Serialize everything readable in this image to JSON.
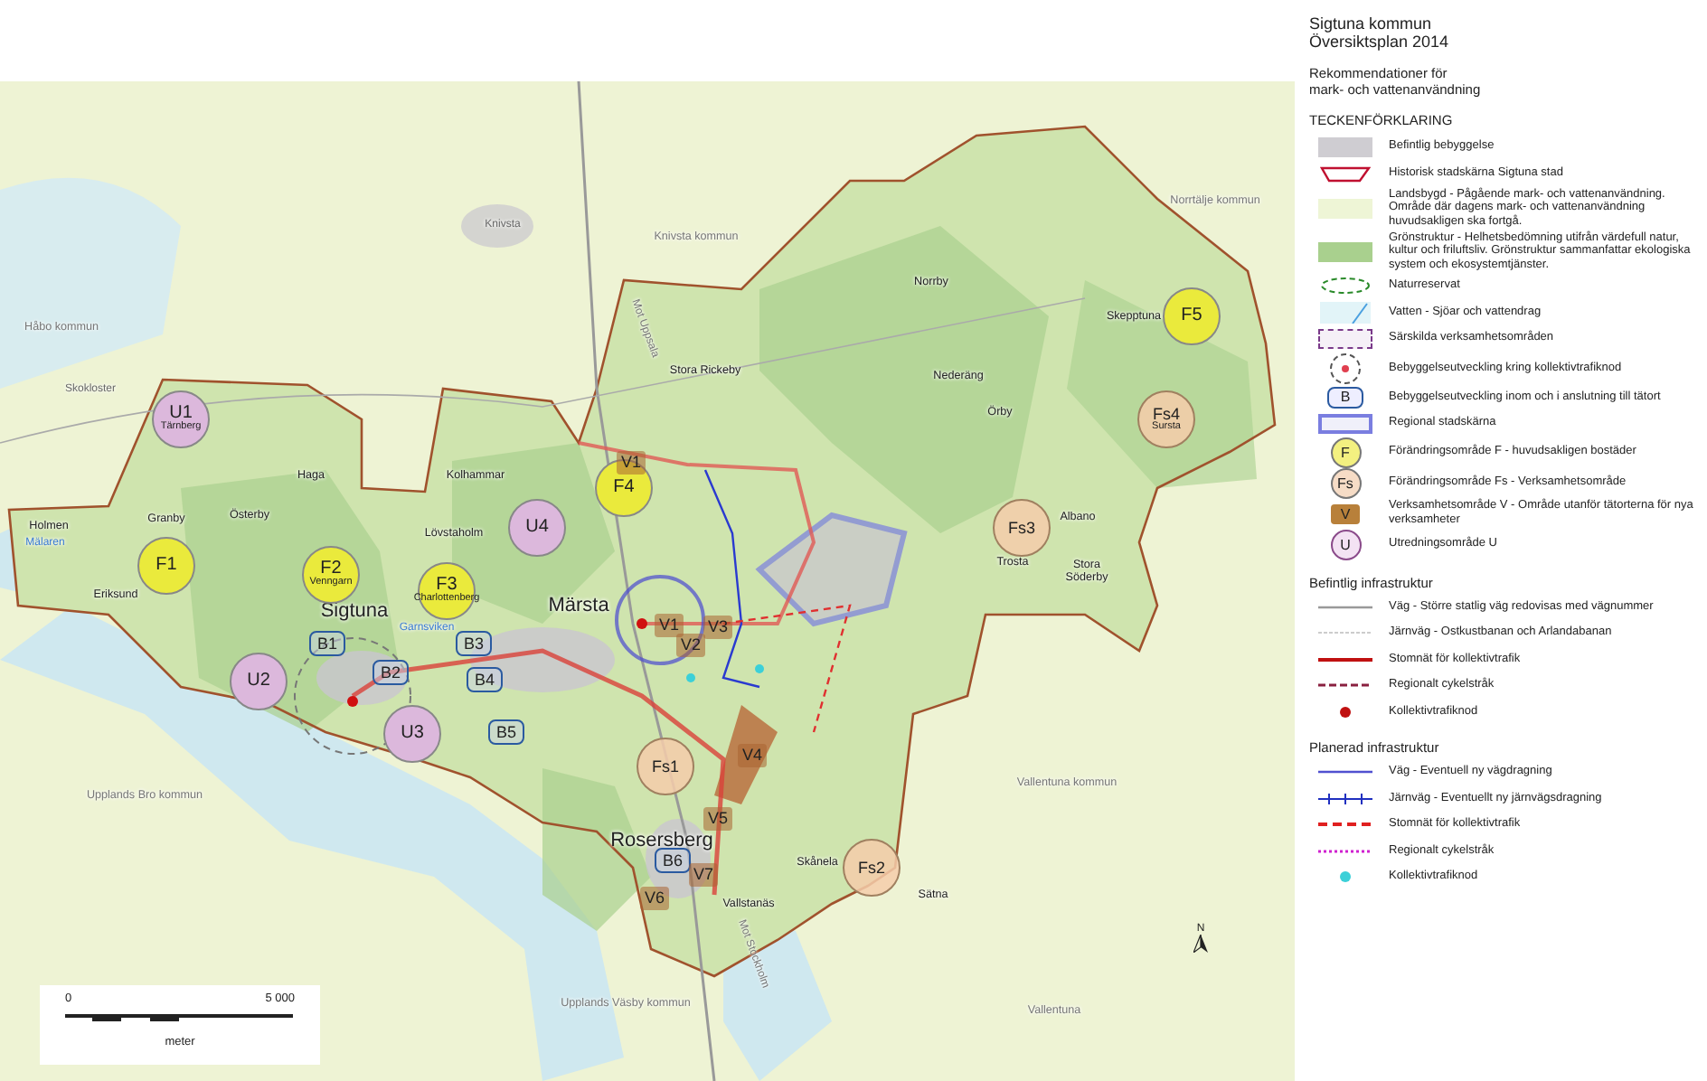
{
  "map": {
    "places": [
      {
        "text": "Knivsta",
        "kind": "village"
      },
      {
        "text": "Knivsta kommun",
        "kind": "municipality"
      },
      {
        "text": "Norrtälje kommun",
        "kind": "municipality"
      },
      {
        "text": "Håbo kommun",
        "kind": "municipality"
      },
      {
        "text": "Skokloster",
        "kind": "village"
      },
      {
        "text": "Mot Uppsala",
        "kind": "direction"
      },
      {
        "text": "Holmen",
        "kind": "place"
      },
      {
        "text": "Mälaren",
        "kind": "water"
      },
      {
        "text": "Granby",
        "kind": "place"
      },
      {
        "text": "Eriksund",
        "kind": "place"
      },
      {
        "text": "Haga",
        "kind": "place"
      },
      {
        "text": "Kolhammar",
        "kind": "place"
      },
      {
        "text": "Österby",
        "kind": "place"
      },
      {
        "text": "Lövstaholm",
        "kind": "place"
      },
      {
        "text": "Sigtuna",
        "kind": "town"
      },
      {
        "text": "Garnsviken",
        "kind": "water"
      },
      {
        "text": "Märsta",
        "kind": "town"
      },
      {
        "text": "Stora Rickeby",
        "kind": "place"
      },
      {
        "text": "Norrby",
        "kind": "place"
      },
      {
        "text": "Nederäng",
        "kind": "place"
      },
      {
        "text": "Örby",
        "kind": "place"
      },
      {
        "text": "Skepptuna",
        "kind": "place"
      },
      {
        "text": "Albano",
        "kind": "place"
      },
      {
        "text": "Trosta",
        "kind": "place"
      },
      {
        "text": "Stora Söderby",
        "kind": "place"
      },
      {
        "text": "Rosersberg",
        "kind": "town"
      },
      {
        "text": "Vallstanäs",
        "kind": "place"
      },
      {
        "text": "Skånela",
        "kind": "place"
      },
      {
        "text": "Sätna",
        "kind": "place"
      },
      {
        "text": "Vallentuna kommun",
        "kind": "municipality"
      },
      {
        "text": "Vallentuna",
        "kind": "municipality"
      },
      {
        "text": "Upplands Bro kommun",
        "kind": "municipality"
      },
      {
        "text": "Upplands Väsby kommun",
        "kind": "municipality"
      },
      {
        "text": "Mot Stockholm",
        "kind": "direction"
      }
    ],
    "zones": [
      {
        "label": "U1",
        "kind": "U",
        "sublabel": "Tärnberg"
      },
      {
        "label": "F1",
        "kind": "F"
      },
      {
        "label": "F2",
        "kind": "F",
        "sublabel": "Venngarn"
      },
      {
        "label": "F3",
        "kind": "F",
        "sublabel": "Charlottenberg"
      },
      {
        "label": "U4",
        "kind": "U"
      },
      {
        "label": "F4",
        "kind": "F"
      },
      {
        "label": "V1",
        "kind": "V"
      },
      {
        "label": "U2",
        "kind": "U"
      },
      {
        "label": "B1",
        "kind": "B"
      },
      {
        "label": "B2",
        "kind": "B"
      },
      {
        "label": "B3",
        "kind": "B"
      },
      {
        "label": "B4",
        "kind": "B"
      },
      {
        "label": "B5",
        "kind": "B"
      },
      {
        "label": "U3",
        "kind": "U"
      },
      {
        "label": "V1",
        "kind": "V"
      },
      {
        "label": "V2",
        "kind": "V"
      },
      {
        "label": "V3",
        "kind": "V"
      },
      {
        "label": "V4",
        "kind": "V"
      },
      {
        "label": "Fs1",
        "kind": "Fs"
      },
      {
        "label": "V5",
        "kind": "V"
      },
      {
        "label": "B6",
        "kind": "B"
      },
      {
        "label": "V6",
        "kind": "V"
      },
      {
        "label": "V7",
        "kind": "V"
      },
      {
        "label": "Fs2",
        "kind": "Fs"
      },
      {
        "label": "Fs3",
        "kind": "Fs"
      },
      {
        "label": "Fs4",
        "kind": "Fs",
        "sublabel": "Sursta"
      },
      {
        "label": "F5",
        "kind": "F"
      }
    ],
    "scale_bar": {
      "start": "0",
      "end": "5 000",
      "unit": "meter"
    },
    "north_arrow": "N"
  },
  "legend": {
    "title": "Sigtuna kommun\nÖversiktsplan 2014",
    "subtitle": "Rekommendationer för\nmark- och vattenanvändning",
    "heading": "TECKENFÖRKLARING",
    "items": [
      {
        "kind": "built",
        "text": "Befintlig bebyggelse"
      },
      {
        "kind": "historic",
        "text": "Historisk stadskärna Sigtuna stad"
      },
      {
        "kind": "rural",
        "text": "Landsbygd - Pågående mark- och vattenanvändning. Område där dagens mark- och vattenanvändning huvudsakligen ska fortgå."
      },
      {
        "kind": "green",
        "text": "Grönstruktur - Helhetsbedömning utifrån värdefull natur, kultur och friluftsliv. Grönstruktur sammanfattar ekologiska system och ekosystemtjänster."
      },
      {
        "kind": "reserve",
        "text": "Naturreservat"
      },
      {
        "kind": "water",
        "text": "Vatten - Sjöar och vattendrag"
      },
      {
        "kind": "special",
        "text": "Särskilda verksamhetsområden"
      },
      {
        "kind": "node_ring",
        "text": "Bebyggelseutveckling kring kollektivtrafiknod"
      },
      {
        "kind": "B",
        "symbol": "B",
        "text": "Bebyggelseutveckling inom och i anslutning till tätort"
      },
      {
        "kind": "regional",
        "text": "Regional stadskärna"
      },
      {
        "kind": "F",
        "symbol": "F",
        "text": "Förändringsområde F - huvudsakligen bostäder"
      },
      {
        "kind": "Fs",
        "symbol": "Fs",
        "text": "Förändringsområde Fs - Verksamhetsområde"
      },
      {
        "kind": "V",
        "symbol": "V",
        "text": "Verksamhetsområde V - Område utanför tätorterna för nya verksamheter"
      },
      {
        "kind": "U",
        "symbol": "U",
        "text": "Utredningsområde U"
      }
    ],
    "sections": [
      {
        "heading": "Befintlig infrastruktur",
        "items": [
          {
            "kind": "road",
            "text": "Väg - Större statlig väg redovisas med vägnummer"
          },
          {
            "kind": "rail",
            "text": "Järnväg - Ostkustbanan och Arlandabanan"
          },
          {
            "kind": "trunk",
            "text": "Stomnät för kollektivtrafik"
          },
          {
            "kind": "cycle",
            "text": "Regionalt cykelstråk"
          },
          {
            "kind": "node",
            "text": "Kollektivtrafiknod"
          }
        ]
      },
      {
        "heading": "Planerad infrastruktur",
        "items": [
          {
            "kind": "planned_road",
            "text": "Väg - Eventuell ny vägdragning"
          },
          {
            "kind": "planned_rail",
            "text": "Järnväg - Eventuellt ny järnvägsdragning"
          },
          {
            "kind": "planned_trunk",
            "text": "Stomnät för kollektivtrafik"
          },
          {
            "kind": "planned_cycle",
            "text": "Regionalt cykelstråk"
          },
          {
            "kind": "planned_node",
            "text": "Kollektivtrafiknod"
          }
        ]
      }
    ]
  }
}
